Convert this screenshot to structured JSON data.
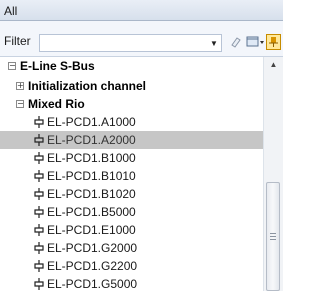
{
  "panel": {
    "title": "All"
  },
  "filter": {
    "label": "Filter",
    "value": ""
  },
  "tree": {
    "root": {
      "label": "E-Line S-Bus",
      "expander": "−"
    },
    "groups": [
      {
        "label": "Initialization channel",
        "expander": "+"
      },
      {
        "label": "Mixed Rio",
        "expander": "−"
      }
    ],
    "items": [
      {
        "label": "EL-PCD1.A1000",
        "selected": false
      },
      {
        "label": "EL-PCD1.A2000",
        "selected": true
      },
      {
        "label": "EL-PCD1.B1000",
        "selected": false
      },
      {
        "label": "EL-PCD1.B1010",
        "selected": false
      },
      {
        "label": "EL-PCD1.B1020",
        "selected": false
      },
      {
        "label": "EL-PCD1.B5000",
        "selected": false
      },
      {
        "label": "EL-PCD1.E1000",
        "selected": false
      },
      {
        "label": "EL-PCD1.G2000",
        "selected": false
      },
      {
        "label": "EL-PCD1.G2200",
        "selected": false
      },
      {
        "label": "EL-PCD1.G5000",
        "selected": false
      }
    ]
  },
  "icons": {
    "dropdown": "chevron-down-icon",
    "clear": "eraser-icon",
    "view": "view-options-icon",
    "pin": "pin-icon",
    "leaf": "io-module-icon",
    "scroll_up": "scroll-up-icon"
  },
  "colors": {
    "selected_row": "#c6c6c6",
    "pin_background": "#ffe89a"
  }
}
